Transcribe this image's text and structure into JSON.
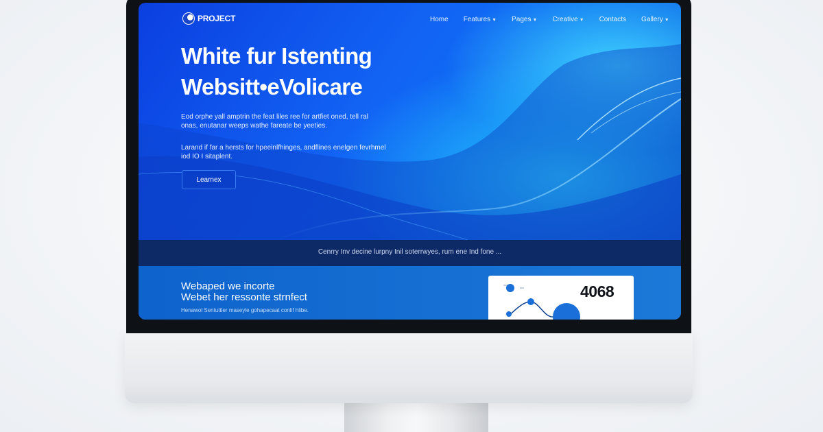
{
  "site": {
    "logo_text": "PROJECT"
  },
  "nav": {
    "items": [
      {
        "label": "Home",
        "has_dropdown": false
      },
      {
        "label": "Features",
        "has_dropdown": true
      },
      {
        "label": "Pages",
        "has_dropdown": true
      },
      {
        "label": "Creative",
        "has_dropdown": true
      },
      {
        "label": "Contacts",
        "has_dropdown": false
      },
      {
        "label": "Gallery",
        "has_dropdown": true
      }
    ],
    "chevron_icon": "chevron-down-icon"
  },
  "hero": {
    "title_line1": "White fur Istenting",
    "title_line2": "Websitt•eVolicare",
    "paragraph1": "Eod orphe yall amptrin the feat liles ree for artfiet oned, tell ral onas, enutanar weeps wathe fareate be yeeties.",
    "paragraph2": "Larand if far a hersts for hpeeinlfhinges, andflines enelgen fevrhmel iod IO I sitaplent.",
    "cta_label": "Learnex"
  },
  "banner": {
    "text": "Cenrry Inv decine lurpny Inil soterrwyes, rum ene Ind fone ..."
  },
  "section": {
    "title_line1": "Webaped we incorte",
    "title_line2": "Webet her ressonte strnfect",
    "subtitle": "Henawol Sentuttler maseyle gohapecaat conlif hlibe."
  },
  "stat_card": {
    "value": "4068"
  },
  "colors": {
    "hero_blue": "#1264f5",
    "banner_navy": "#0d2a66",
    "cta_blue": "#0a3fc9",
    "accent_cyan": "#27c4ff"
  }
}
